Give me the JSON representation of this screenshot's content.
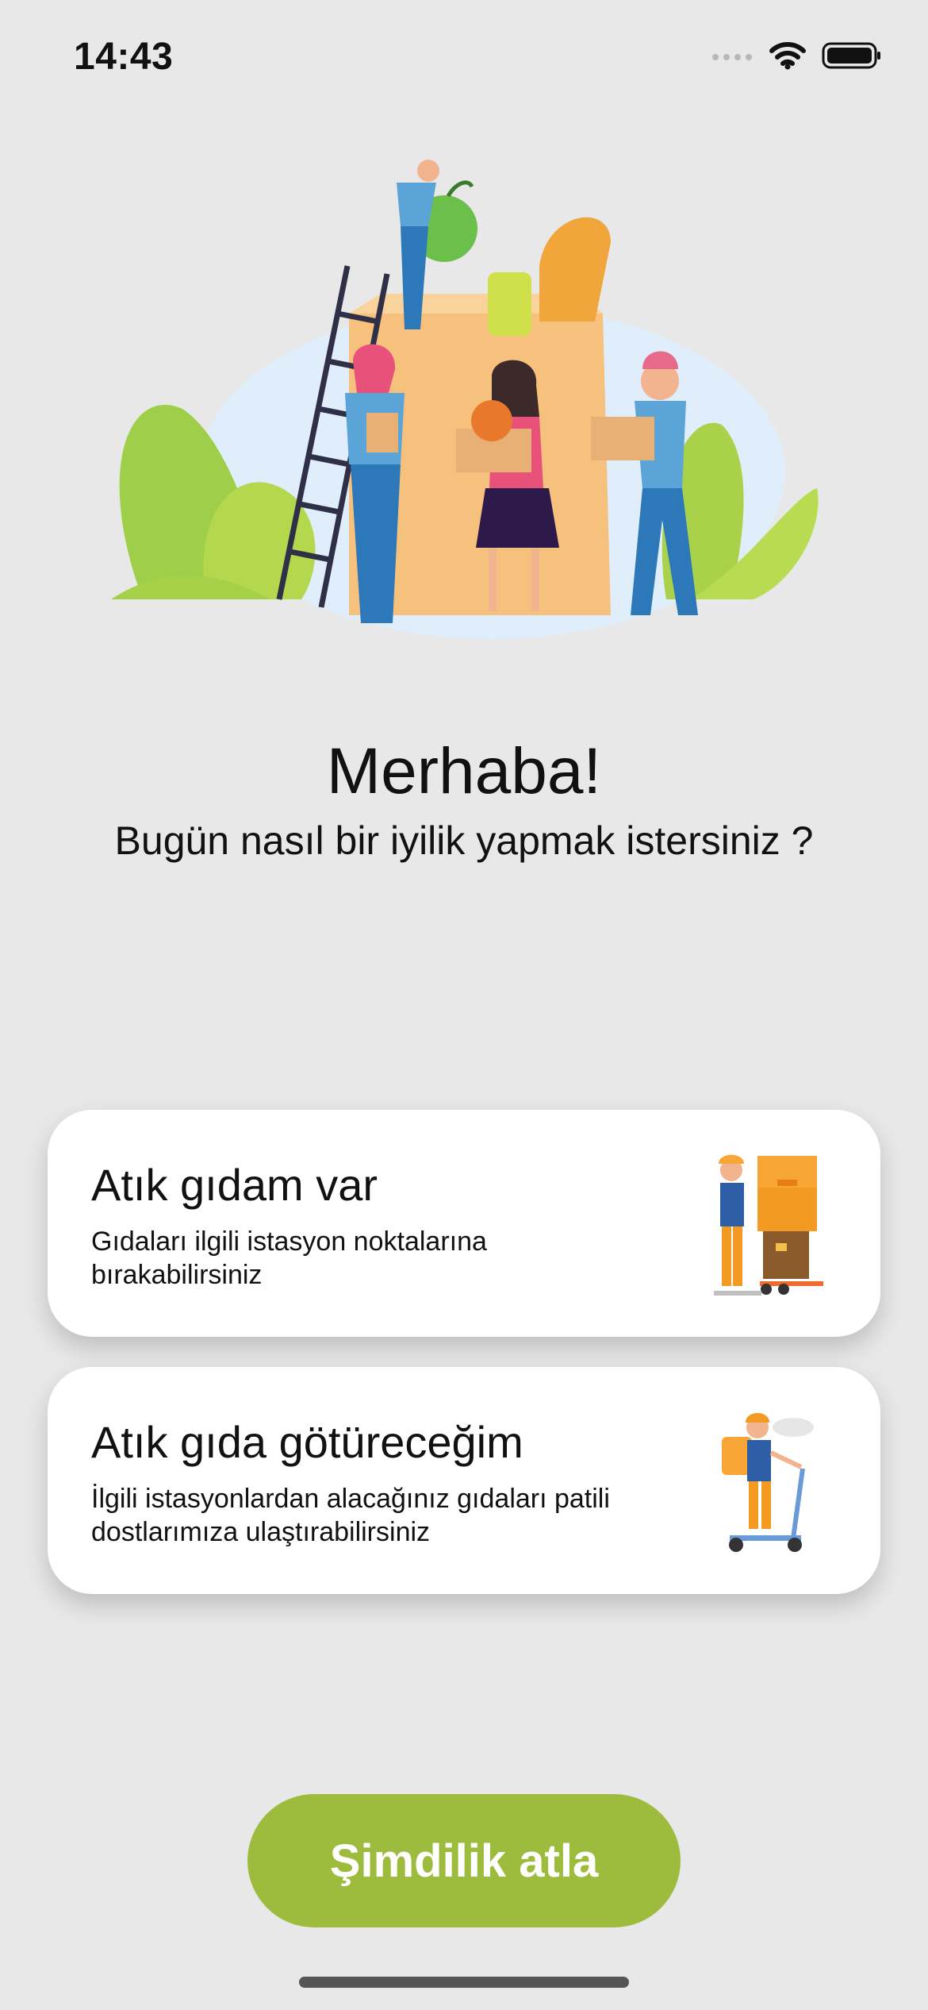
{
  "status_bar": {
    "time": "14:43"
  },
  "greeting": {
    "title": "Merhaba!",
    "subtitle": "Bugün nasıl bir iyilik yapmak istersiniz ?"
  },
  "options": [
    {
      "title": "Atık gıdam var",
      "description": "Gıdaları ilgili istasyon noktalarına bırakabilirsiniz",
      "icon": "delivery-worker-boxes-icon"
    },
    {
      "title": "Atık gıda götüreceğim",
      "description": "İlgili istasyonlardan alacağınız gıdaları patili dostlarımıza ulaştırabilirsiniz",
      "icon": "courier-scooter-icon"
    }
  ],
  "skip_button": {
    "label": "Şimdilik atla"
  },
  "colors": {
    "background": "#e8e8e8",
    "accent": "#9dbb3c",
    "card": "#ffffff"
  }
}
